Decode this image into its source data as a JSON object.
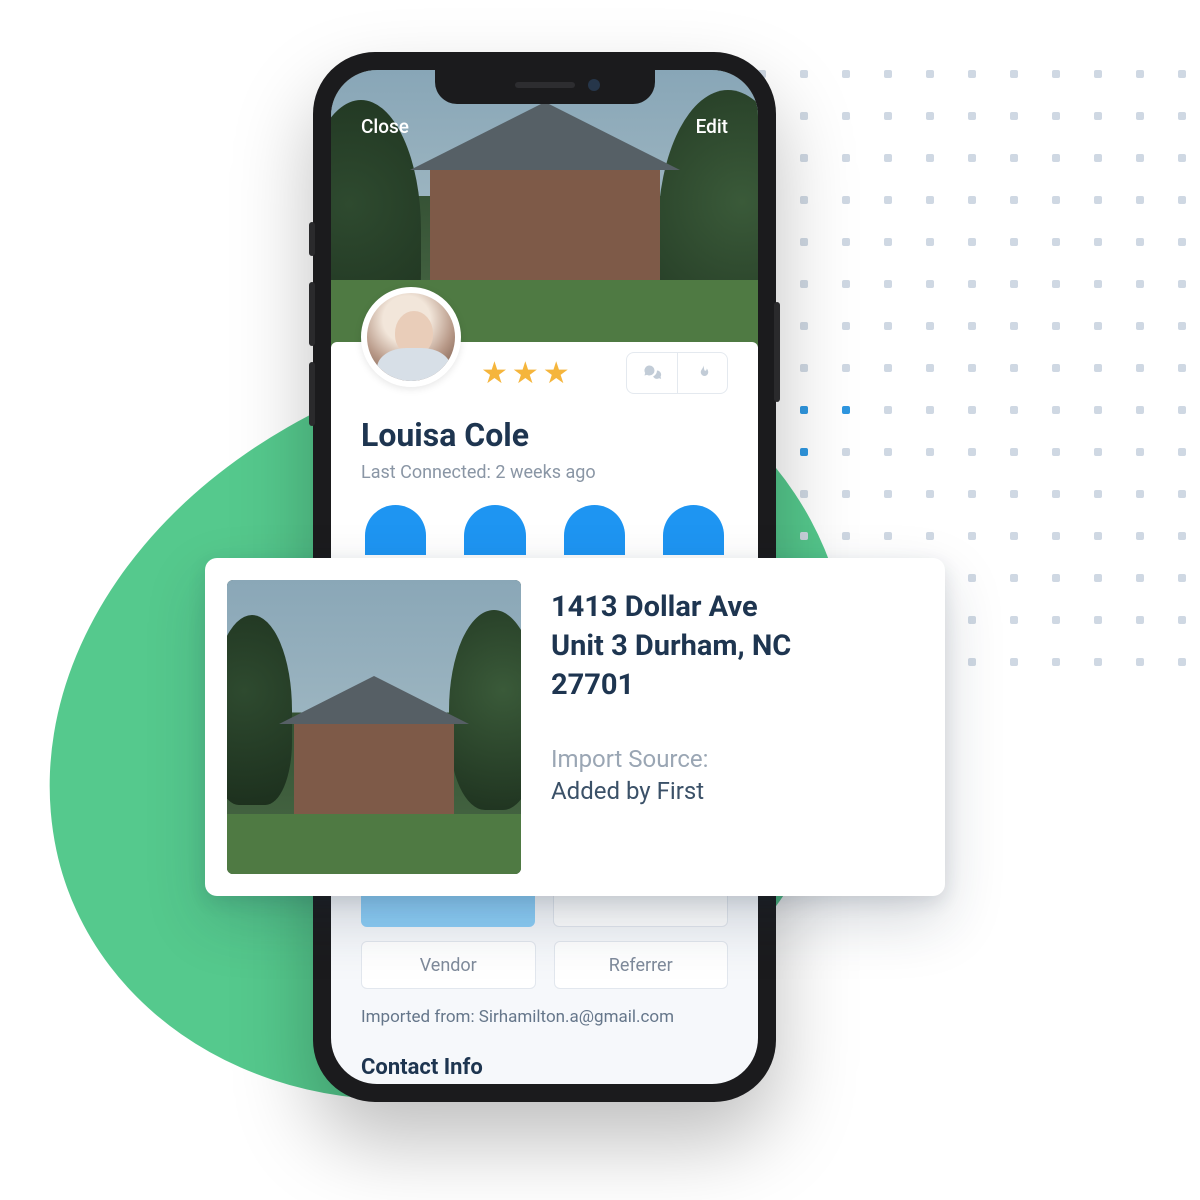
{
  "header": {
    "close_label": "Close",
    "edit_label": "Edit"
  },
  "profile": {
    "name": "Louisa Cole",
    "last_connected_label": "Last Connected: 2 weeks ago",
    "stars": 3
  },
  "tags": {
    "vendor_label": "Vendor",
    "referrer_label": "Referrer"
  },
  "import_line": "Imported from: Sirhamilton.a@gmail.com",
  "section_contact_info": "Contact Info",
  "address_card": {
    "line1": "1413 Dollar Ave",
    "line2": "Unit 3 Durham, NC",
    "line3": "27701",
    "import_source_label": "Import Source:",
    "import_source_value": "Added by First"
  }
}
